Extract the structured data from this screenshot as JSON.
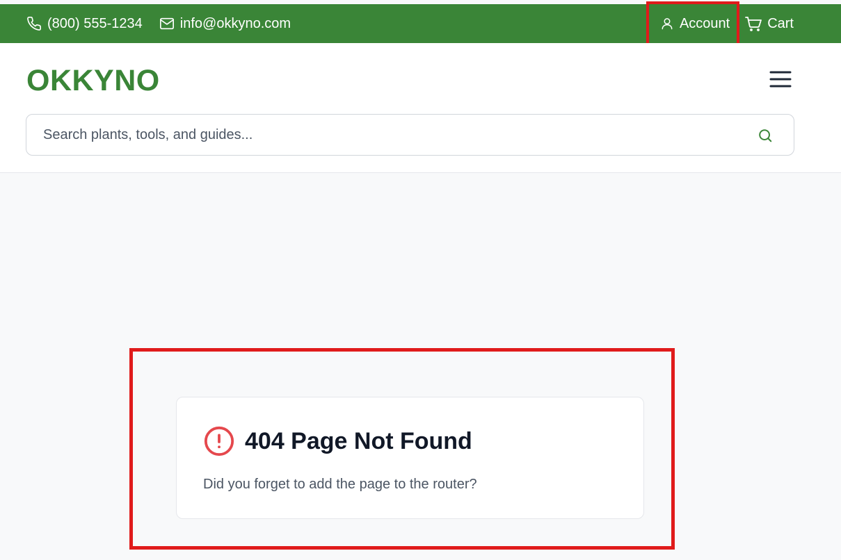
{
  "topbar": {
    "phone": "(800) 555-1234",
    "email": "info@okkyno.com",
    "account_label": "Account",
    "cart_label": "Cart",
    "phone_icon": "phone-icon",
    "email_icon": "mail-icon",
    "account_icon": "user-icon",
    "cart_icon": "cart-icon"
  },
  "header": {
    "logo": "OKKYNO",
    "menu_icon": "hamburger-menu-icon"
  },
  "search": {
    "placeholder": "Search plants, tools, and guides...",
    "value": "",
    "icon": "search-icon"
  },
  "error": {
    "title": "404 Page Not Found",
    "message": "Did you forget to add the page to the router?",
    "icon": "alert-circle-icon"
  },
  "colors": {
    "brand_green": "#3a8537",
    "error_red": "#e5484d",
    "highlight_red": "#e01b1b",
    "page_bg": "#f8f9fa"
  }
}
